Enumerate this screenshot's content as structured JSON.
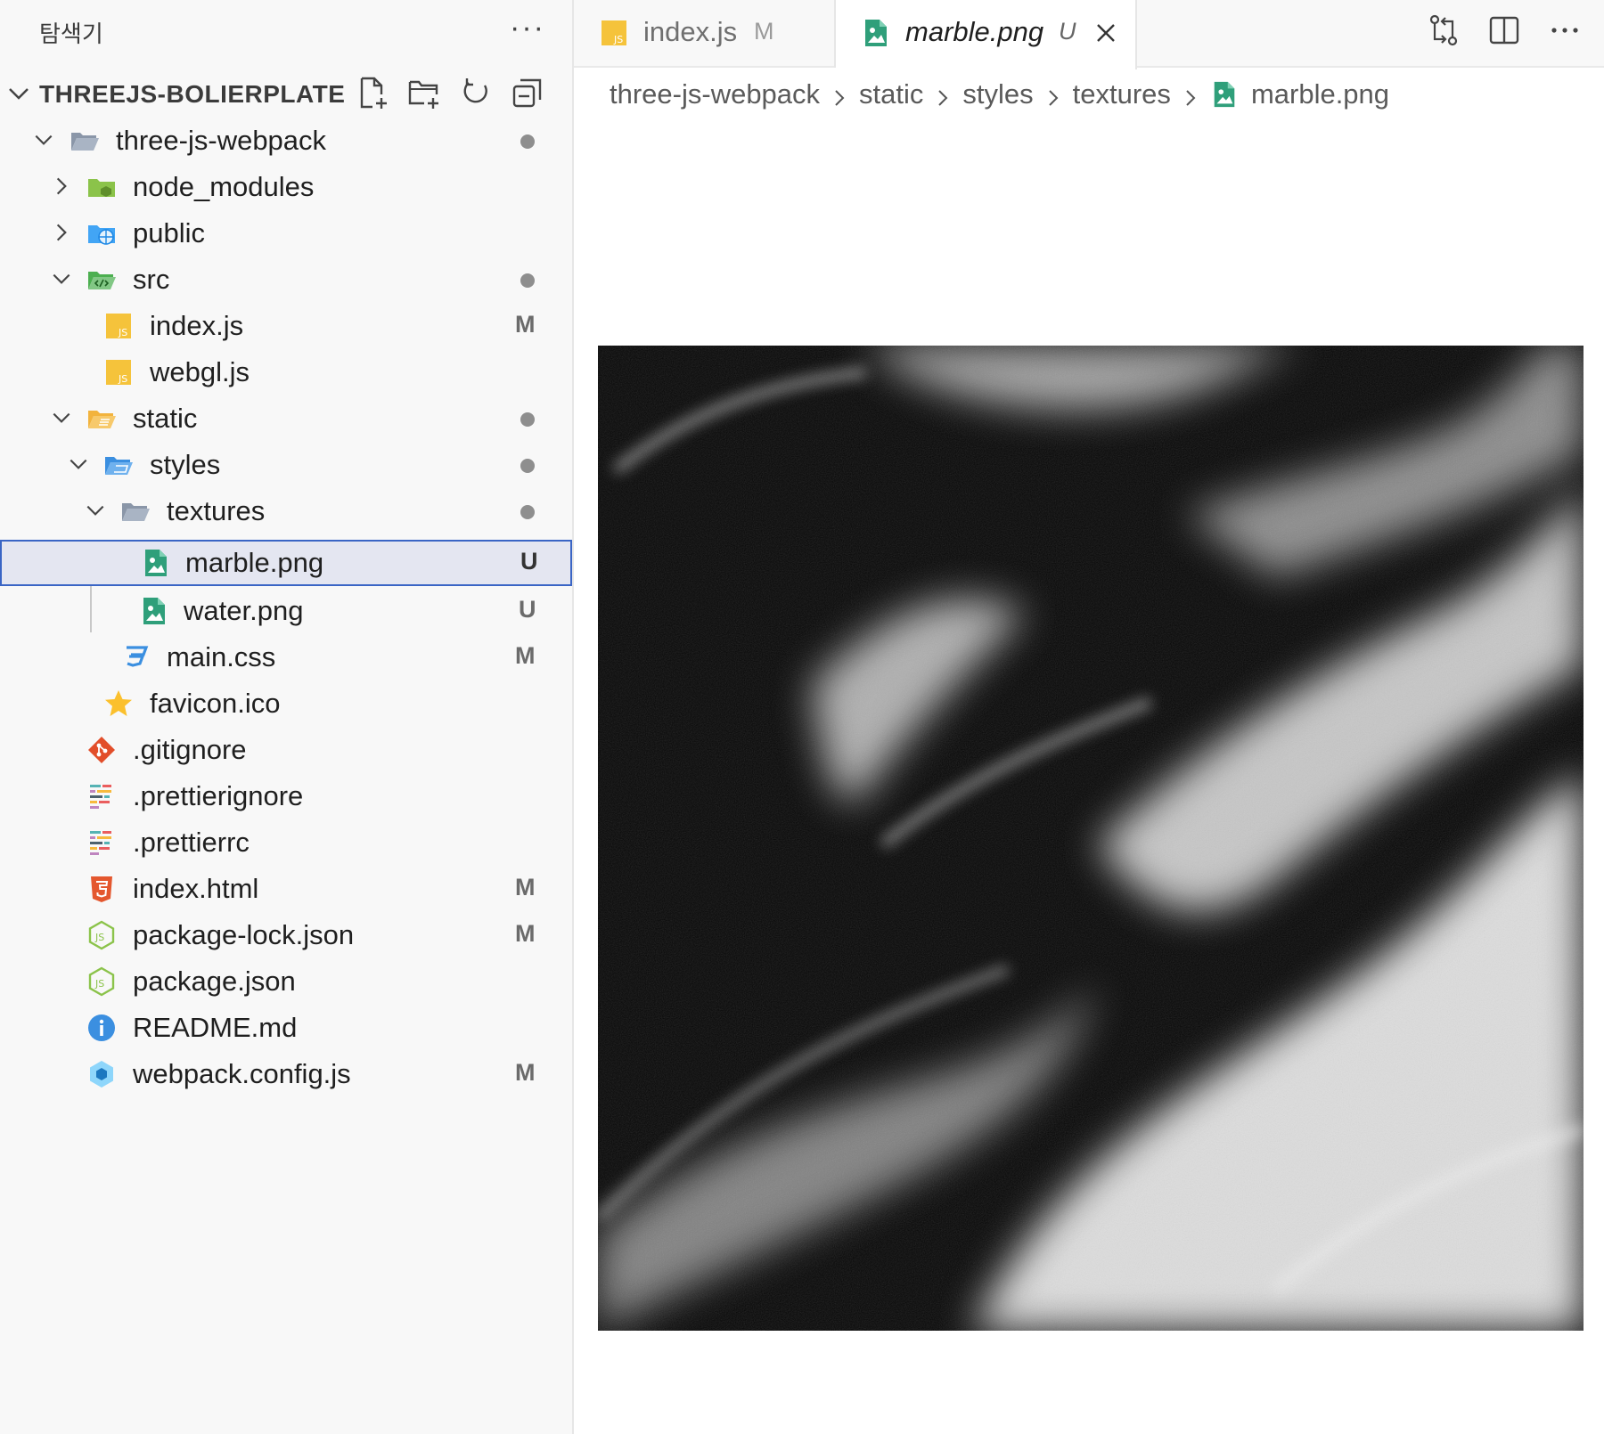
{
  "sidebar": {
    "title": "탐색기",
    "more_icon": "ellipsis-icon",
    "project": {
      "name": "THREEJS-BOLIERPLATE",
      "actions": [
        "new-file-icon",
        "new-folder-icon",
        "refresh-icon",
        "collapse-all-icon"
      ]
    },
    "tree": [
      {
        "label": "three-js-webpack",
        "icon": "folder-open-icon",
        "expanded": true,
        "status": "dot"
      },
      {
        "label": "node_modules",
        "icon": "node-folder-icon",
        "expanded": false
      },
      {
        "label": "public",
        "icon": "public-folder-icon",
        "expanded": false
      },
      {
        "label": "src",
        "icon": "src-folder-icon",
        "expanded": true,
        "status": "dot"
      },
      {
        "label": "index.js",
        "icon": "javascript-file-icon",
        "badge": "M"
      },
      {
        "label": "webgl.js",
        "icon": "javascript-file-icon"
      },
      {
        "label": "static",
        "icon": "static-folder-icon",
        "expanded": true,
        "status": "dot"
      },
      {
        "label": "styles",
        "icon": "styles-folder-icon",
        "expanded": true,
        "status": "dot"
      },
      {
        "label": "textures",
        "icon": "folder-open-icon",
        "expanded": true,
        "status": "dot"
      },
      {
        "label": "marble.png",
        "icon": "image-file-icon",
        "badge": "U",
        "selected": true
      },
      {
        "label": "water.png",
        "icon": "image-file-icon",
        "badge": "U"
      },
      {
        "label": "main.css",
        "icon": "css-file-icon",
        "badge": "M"
      },
      {
        "label": "favicon.ico",
        "icon": "star-favicon-icon"
      },
      {
        "label": ".gitignore",
        "icon": "git-icon"
      },
      {
        "label": ".prettierignore",
        "icon": "prettier-icon"
      },
      {
        "label": ".prettierrc",
        "icon": "prettier-icon"
      },
      {
        "label": "index.html",
        "icon": "html5-icon",
        "badge": "M"
      },
      {
        "label": "package-lock.json",
        "icon": "nodejs-icon",
        "badge": "M"
      },
      {
        "label": "package.json",
        "icon": "nodejs-icon"
      },
      {
        "label": "README.md",
        "icon": "info-icon"
      },
      {
        "label": "webpack.config.js",
        "icon": "webpack-icon",
        "badge": "M"
      }
    ]
  },
  "tabs": [
    {
      "label": "index.js",
      "badge": "M",
      "icon": "javascript-file-icon",
      "active": false
    },
    {
      "label": "marble.png",
      "badge": "U",
      "icon": "image-file-icon",
      "active": true,
      "close_icon": "close-icon"
    }
  ],
  "toolbar_icons": [
    "compare-changes-icon",
    "split-editor-icon",
    "ellipsis-icon"
  ],
  "breadcrumbs": [
    "three-js-webpack",
    "static",
    "styles",
    "textures",
    "marble.png"
  ],
  "colors": {
    "accent": "#3a65c5",
    "selected_bg": "#e4e6f1",
    "js_yellow": "#f5c33b",
    "image_green": "#2f9f7a",
    "css_blue": "#3b8fe0",
    "html_orange": "#e4572e",
    "git_red": "#e24e2a",
    "node_green": "#8bc34a"
  }
}
